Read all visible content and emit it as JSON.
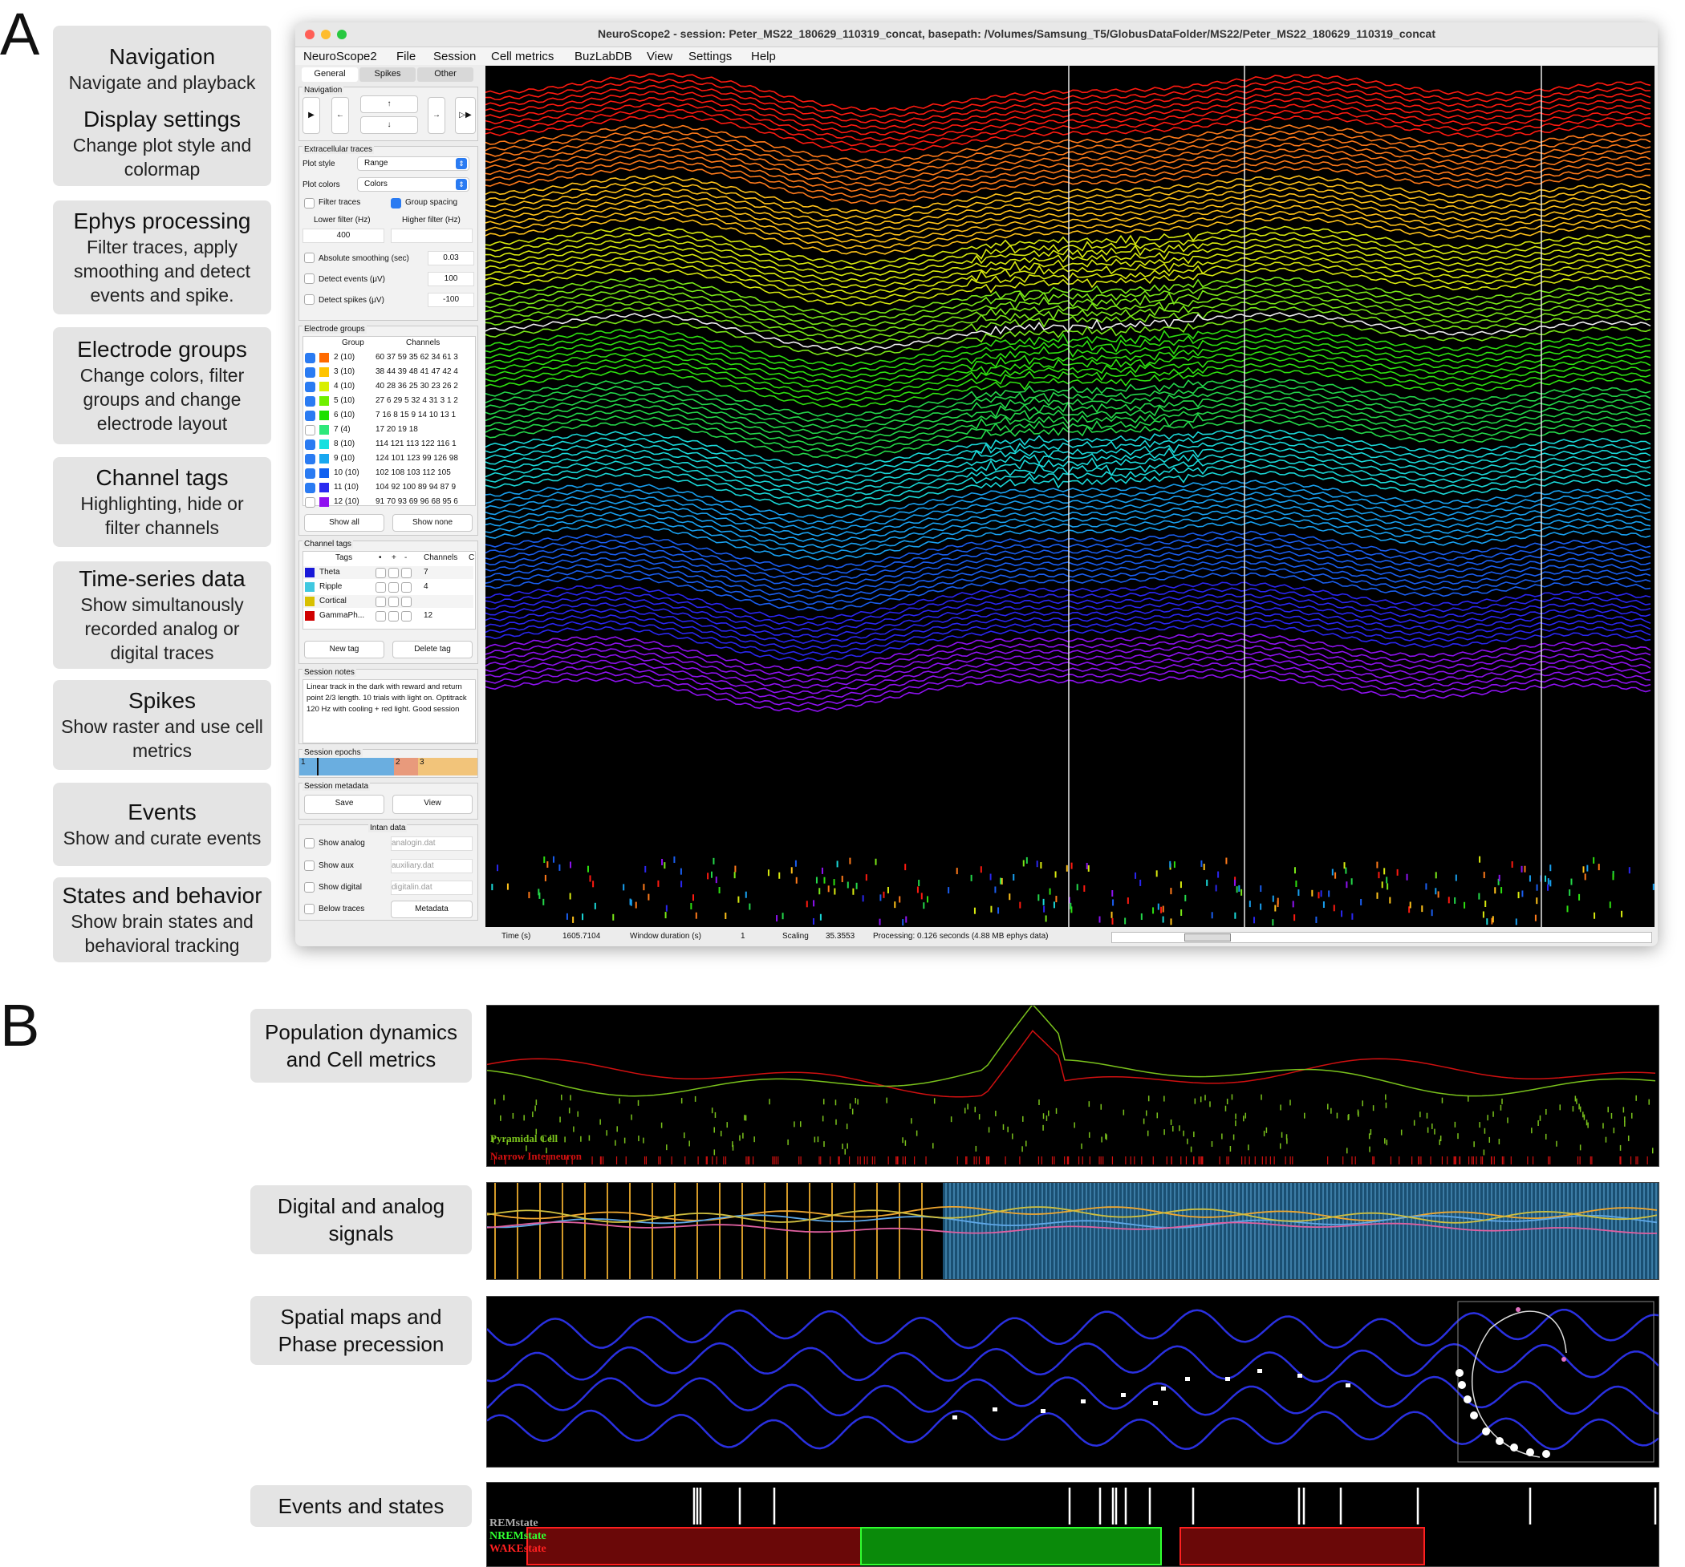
{
  "panels": {
    "a": "A",
    "b": "B"
  },
  "side_labels": [
    {
      "title": "Navigation",
      "desc": "Navigate and playback"
    },
    {
      "title": "Display settings",
      "desc": "Change plot style and colormap"
    },
    {
      "title": "Ephys processing",
      "desc": "Filter traces, apply smoothing and detect events and spike."
    },
    {
      "title": "Electrode groups",
      "desc": "Change colors, filter groups and change electrode layout"
    },
    {
      "title": "Channel tags",
      "desc": "Highlighting, hide or filter channels"
    },
    {
      "title": "Time-series data",
      "desc": "Show simultanously recorded analog or digital traces"
    },
    {
      "title": "Spikes",
      "desc": "Show raster and use cell metrics"
    },
    {
      "title": "Events",
      "desc": "Show and curate events"
    },
    {
      "title": "States and behavior",
      "desc": "Show brain states and behavioral tracking"
    }
  ],
  "window": {
    "title": "NeuroScope2  -  session: Peter_MS22_180629_110319_concat, basepath: /Volumes/Samsung_T5/GlobusDataFolder/MS22/Peter_MS22_180629_110319_concat",
    "menu": [
      "NeuroScope2",
      "File",
      "Session",
      "Cell metrics",
      "BuzLabDB",
      "View",
      "Settings",
      "Help"
    ],
    "tabs": [
      "General",
      "Spikes",
      "Other"
    ],
    "nav": {
      "title": "Navigation",
      "play": "▶",
      "back": "←",
      "up": "↑",
      "down": "↓",
      "fwd": "→",
      "ffwd": "▷▶"
    },
    "extracellular": {
      "title": "Extracellular traces",
      "plot_style_label": "Plot style",
      "plot_style": "Range",
      "plot_colors_label": "Plot colors",
      "plot_colors": "Colors",
      "filter_traces": "Filter traces",
      "group_spacing": "Group spacing",
      "lower_filter": "Lower filter (Hz)",
      "higher_filter": "Higher filter (Hz)",
      "lower_value": "400",
      "abs_smoothing": "Absolute smoothing (sec)",
      "abs_smoothing_value": "0.03",
      "detect_events": "Detect events (μV)",
      "detect_events_value": "100",
      "detect_spikes": "Detect spikes (μV)",
      "detect_spikes_value": "-100"
    },
    "electrode_groups": {
      "title": "Electrode groups",
      "col_group": "Group",
      "col_channels": "Channels",
      "rows": [
        {
          "group": "2 (10)",
          "channels": "60 37 59 35 62 34 61 3",
          "color": "#ff6a00",
          "checked": true
        },
        {
          "group": "3 (10)",
          "channels": "38 44 39 48 41 47 42 4",
          "color": "#ffc400",
          "checked": true
        },
        {
          "group": "4 (10)",
          "channels": "40 28 36 25 30 23 26 2",
          "color": "#d8ef00",
          "checked": true
        },
        {
          "group": "5 (10)",
          "channels": "27 6 29 5 32 4 31 3 1 2",
          "color": "#6ef000",
          "checked": true
        },
        {
          "group": "6 (10)",
          "channels": "7 16 8 15 9 14 10 13 1",
          "color": "#1ee000",
          "checked": true
        },
        {
          "group": "7 (4)",
          "channels": "17 20 19 18",
          "color": "#2ee87a",
          "checked": false
        },
        {
          "group": "8 (10)",
          "channels": "114 121 113 122 116 1",
          "color": "#16e0e0",
          "checked": true
        },
        {
          "group": "9 (10)",
          "channels": "124 101 123 99 126 98",
          "color": "#18a8f0",
          "checked": true
        },
        {
          "group": "10 (10)",
          "channels": "102 108 103 112 105",
          "color": "#1060f0",
          "checked": true
        },
        {
          "group": "11 (10)",
          "channels": "104 92 100 89 94 87 9",
          "color": "#2a2af0",
          "checked": true
        },
        {
          "group": "12 (10)",
          "channels": "91 70 93 69 96 68 95 6",
          "color": "#9010f0",
          "checked": false
        }
      ],
      "show_all": "Show all",
      "show_none": "Show none"
    },
    "channel_tags": {
      "title": "Channel tags",
      "col_tags": "Tags",
      "col_dot": "•",
      "col_plus": "+",
      "col_minus": "-",
      "col_channels": "Channels",
      "col_c": "C",
      "rows": [
        {
          "tag": "Theta",
          "color": "#1818d8",
          "channels": "7"
        },
        {
          "tag": "Ripple",
          "color": "#40c8e0",
          "channels": "4"
        },
        {
          "tag": "Cortical",
          "color": "#d8c000",
          "channels": ""
        },
        {
          "tag": "GammaPh...",
          "color": "#d00000",
          "channels": "12"
        }
      ],
      "new_tag": "New tag",
      "delete_tag": "Delete tag"
    },
    "session_notes": {
      "title": "Session notes",
      "text": "Linear track in the dark with reward and return point 2/3 length. 10 trials with light on. Optitrack 120 Hz with cooling + red light. Good session"
    },
    "session_epochs": {
      "title": "Session epochs",
      "epochs": [
        "1",
        "2",
        "3"
      ]
    },
    "session_metadata": {
      "title": "Session metadata",
      "save": "Save",
      "view": "View"
    },
    "intan": {
      "title": "Intan data",
      "show_analog": "Show analog",
      "analog_file": "analogin.dat",
      "show_aux": "Show aux",
      "aux_file": "auxiliary.dat",
      "show_digital": "Show digital",
      "digital_file": "digitalin.dat",
      "below_traces": "Below traces",
      "metadata": "Metadata"
    },
    "status": {
      "time_label": "Time (s)",
      "time_value": "1605.7104",
      "window_label": "Window duration (s)",
      "window_value": "1",
      "scaling_label": "Scaling",
      "scaling_value": "35.3553",
      "processing": "Processing: 0.126 seconds (4.88 MB ephys data)"
    }
  },
  "b_labels": [
    {
      "title": "Population dynamics and Cell metrics"
    },
    {
      "title": "Digital and analog signals"
    },
    {
      "title": "Spatial maps and Phase precession"
    },
    {
      "title": "Events and states"
    }
  ],
  "b_legends": {
    "pyr": "Pyramidal Cell",
    "ni": "Narrow Interneuron",
    "rem": "REMstate",
    "nrem": "NREMstate",
    "wake": "WAKEstate"
  },
  "colors": {
    "pyr": "#7ac21c",
    "ni": "#d01010",
    "wake": "#6a0808",
    "nrem": "#0a8a0a",
    "rem": "#9a9a9a"
  }
}
